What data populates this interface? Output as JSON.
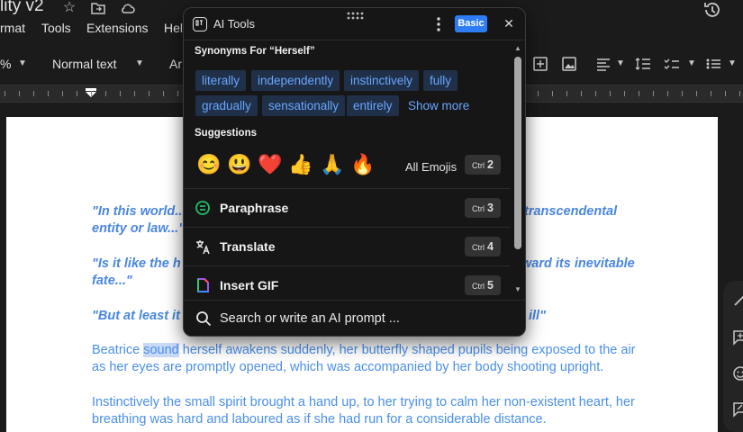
{
  "docs": {
    "title": "lity v2",
    "menu": [
      "rmat",
      "Tools",
      "Extensions",
      "Hel"
    ],
    "toolbar": {
      "zoom_fragment": "%",
      "style": "Normal text",
      "font_fragment": "Ar"
    }
  },
  "document": {
    "quote_lines": [
      "\"In this world...",
      "transcendental",
      "entity or law...\"",
      "\"Is it like the h",
      "ward its inevitable",
      "fate...\"",
      "\"But at least it",
      "ill\""
    ],
    "para1": {
      "pre": "Beatrice ",
      "selected": "sound",
      "post": " herself awakens suddenly, her butterfly shaped pupils being exposed to the air",
      "line2": "as her eyes are promptly opened, which was accompanied by her body shooting upright."
    },
    "para2": {
      "line1": "Instinctively the small spirit brought a hand up, to her trying to calm her non-existent heart, her",
      "line2": "breathing was hard and laboured as if she had run for a considerable distance."
    }
  },
  "popup": {
    "title": "AI Tools",
    "badge": "Basic",
    "synonyms_heading": "Synonyms For “Herself”",
    "synonyms": [
      "literally",
      "independently",
      "instinctively",
      "fully",
      "gradually",
      "sensationally",
      "entirely"
    ],
    "show_more": "Show more",
    "suggestions_heading": "Suggestions",
    "emojis": [
      "😊",
      "😃",
      "❤️",
      "👍",
      "🙏",
      "🔥"
    ],
    "all_emojis": "All Emojis",
    "actions": [
      {
        "label": "Paraphrase",
        "kbd_mod": "Ctrl",
        "kbd_key": "3"
      },
      {
        "label": "Translate",
        "kbd_mod": "Ctrl",
        "kbd_key": "4"
      },
      {
        "label": "Insert GIF",
        "kbd_mod": "Ctrl",
        "kbd_key": "5"
      }
    ],
    "emoji_kbd": {
      "mod": "Ctrl",
      "key": "2"
    },
    "prompt_placeholder": "Search or write an AI prompt ..."
  },
  "colors": {
    "accent": "#2e7cf6",
    "chip_bg": "#1f3048",
    "chip_text": "#6aa6ff",
    "doc_text": "#4a8fe8"
  }
}
